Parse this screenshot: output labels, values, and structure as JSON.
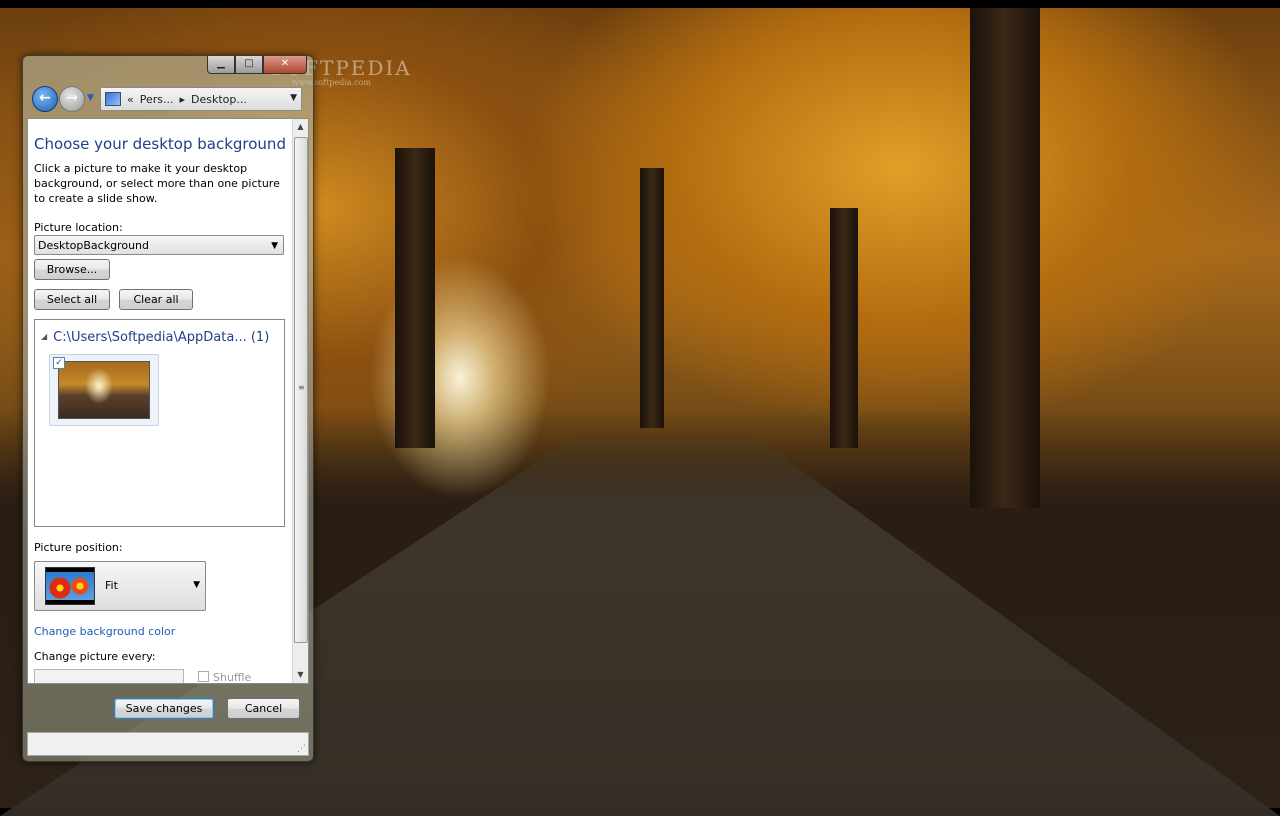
{
  "desktop": {
    "watermark": "SOFTPEDIA",
    "watermark_sub": "www.softpedia.com"
  },
  "window": {
    "caption": {
      "minimize": "▁",
      "maximize": "□",
      "close": "✕"
    },
    "address": {
      "prefix": "«",
      "crumb_1": "Pers...",
      "separator": "▸",
      "crumb_2": "Desktop..."
    },
    "heading": "Choose your desktop background",
    "description": "Click a picture to make it your desktop background, or select more than one picture to create a slide show.",
    "picture_location_label": "Picture location:",
    "picture_location_value": "DesktopBackground",
    "browse_label": "Browse...",
    "select_all_label": "Select all",
    "clear_all_label": "Clear all",
    "group_header": "C:\\Users\\Softpedia\\AppData... (1)",
    "thumbnail_checked": "✓",
    "picture_position_label": "Picture position:",
    "picture_position_value": "Fit",
    "change_bg_color_link": "Change background color",
    "change_picture_every_label": "Change picture every:",
    "interval_value": "",
    "shuffle_label": "Shuffle",
    "save_label": "Save changes",
    "cancel_label": "Cancel"
  },
  "icons": [
    "back-arrow-icon",
    "forward-arrow-icon",
    "control-panel-icon",
    "chevron-down-icon",
    "resize-grip-icon"
  ],
  "colors": {
    "heading": "#1e3f8a",
    "link": "#1e5db5",
    "close_button": "#b04830"
  }
}
